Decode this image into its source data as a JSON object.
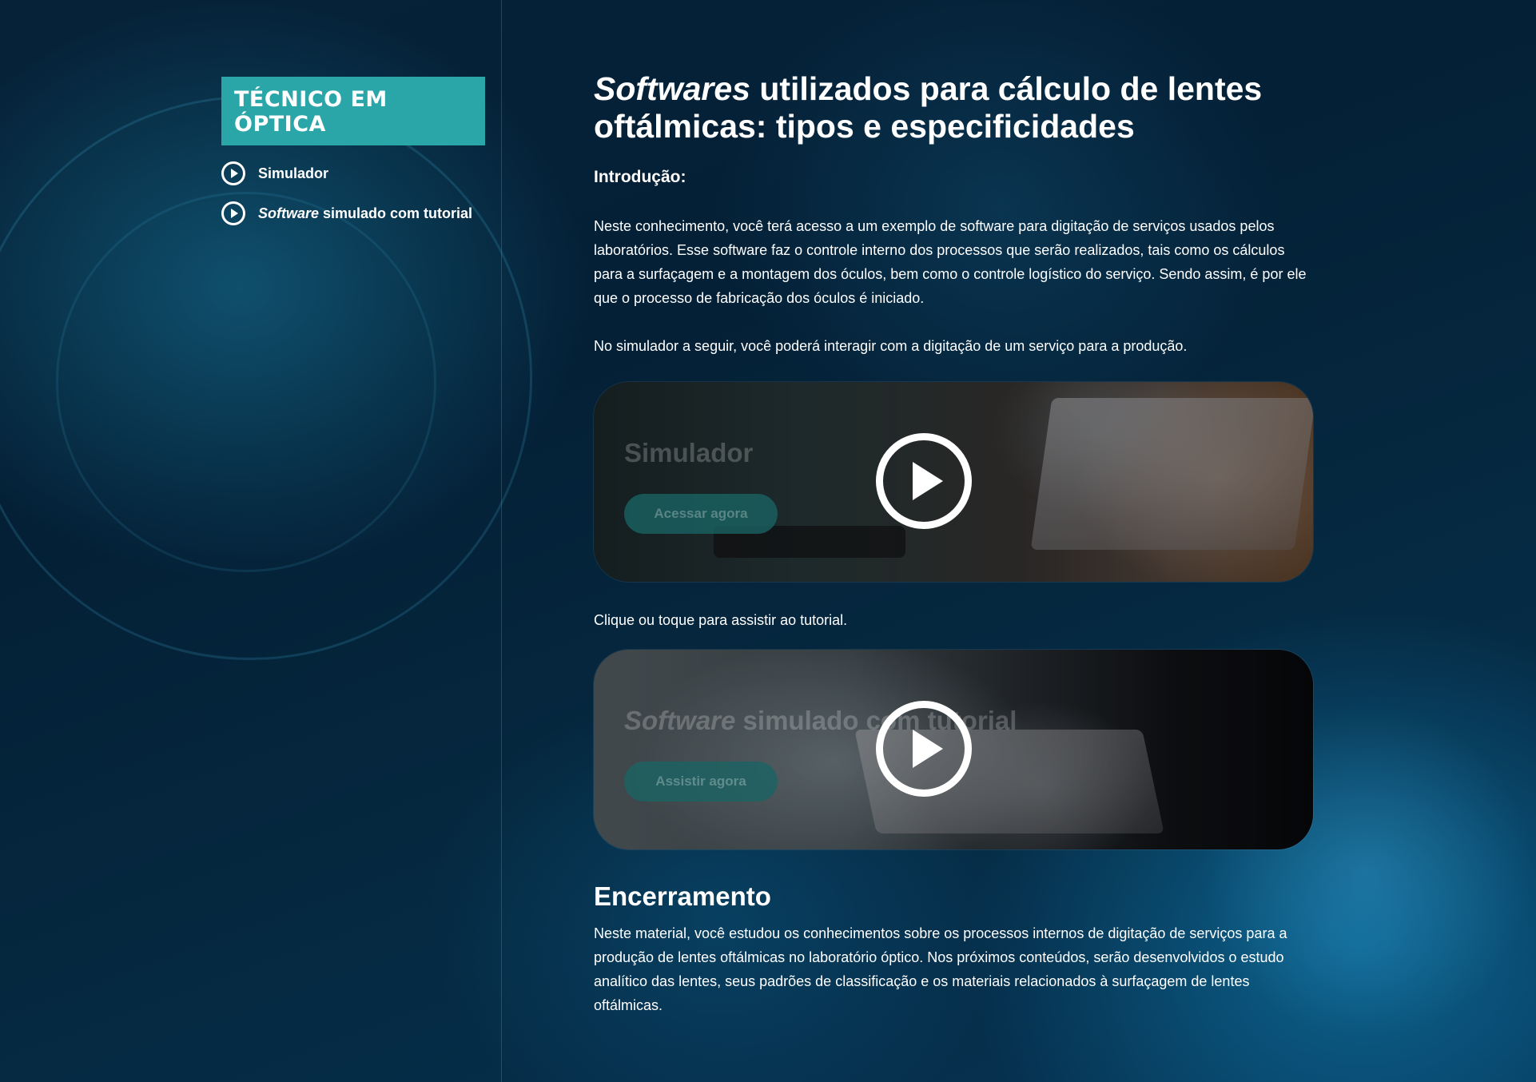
{
  "sidebar": {
    "brand": "TÉCNICO EM ÓPTICA",
    "items": [
      {
        "label": "Simulador",
        "icon": "play-circle-icon"
      },
      {
        "label_em": "Software",
        "label_rest": " simulado com tutorial",
        "icon": "play-circle-icon"
      }
    ]
  },
  "main": {
    "title_em": "Softwares",
    "title_rest": " utilizados para cálculo de lentes oftálmicas: tipos e especificidades",
    "intro_heading": "Introdução:",
    "intro_p1": "Neste conhecimento, você terá acesso a um exemplo de software para digitação de serviços usados pelos laboratórios. Esse software faz o controle interno dos processos que serão realizados, tais como os cálculos para a surfaçagem e a montagem dos óculos, bem como o controle logístico do serviço. Sendo assim, é por ele que o processo de fabricação dos óculos é iniciado.",
    "intro_p2": "No simulador a seguir, você poderá interagir com a digitação de um serviço para a produção.",
    "card1": {
      "title": "Simulador",
      "button": "Acessar agora",
      "icon": "play-circle-icon"
    },
    "tutorial_caption": "Clique ou toque para assistir ao tutorial.",
    "card2": {
      "title_em": "Software",
      "title_rest": " simulado com tutorial",
      "button": "Assistir agora",
      "icon": "play-circle-icon"
    },
    "closing_heading": "Encerramento",
    "closing_text": "Neste material, você estudou os conhecimentos sobre os processos internos de digitação de serviços para a produção de lentes oftálmicas no laboratório óptico. Nos próximos conteúdos, serão desenvolvidos o estudo analítico das lentes, seus padrões de classificação e os materiais relacionados à surfaçagem de lentes oftálmicas."
  },
  "colors": {
    "brand_teal": "#2aa6a8",
    "background": "#041a2c",
    "card_button": "#1a6464"
  }
}
